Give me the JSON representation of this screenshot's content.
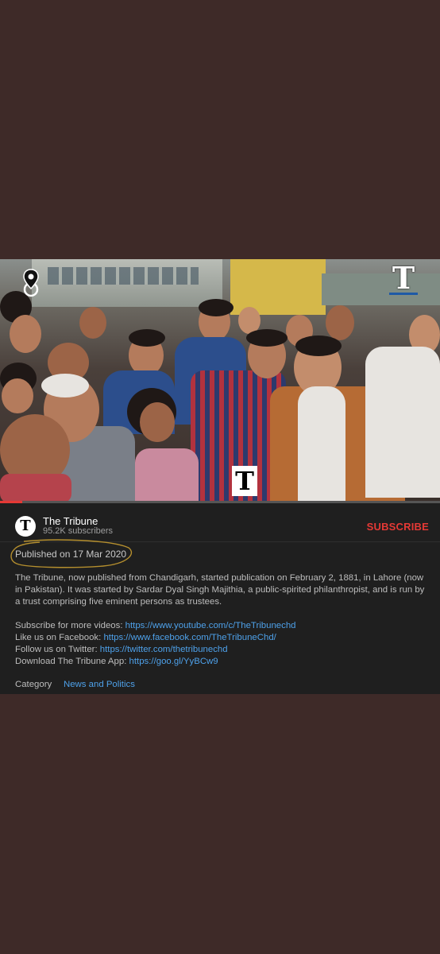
{
  "video": {
    "logo_letter": "T",
    "progress_fraction": 0.05,
    "icons": {
      "location": "location-pin-icon",
      "logo": "tribune-logo-icon"
    }
  },
  "channel": {
    "avatar_letter": "T",
    "name": "The Tribune",
    "subscribers": "95.2K subscribers",
    "subscribe_label": "SUBSCRIBE"
  },
  "published": "Published on 17 Mar 2020",
  "description": {
    "paragraph": "The Tribune, now published from Chandigarh, started publication on February 2, 1881, in Lahore (now in Pakistan). It was started by Sardar Dyal Singh Majithia, a public-spirited philanthropist, and is run by a trust comprising five eminent persons as trustees.",
    "links": [
      {
        "prefix": "Subscribe for more videos: ",
        "url": "https://www.youtube.com/c/TheTribunechd"
      },
      {
        "prefix": "Like us on Facebook: ",
        "url": "https://www.facebook.com/TheTribuneChd/"
      },
      {
        "prefix": "Follow us on Twitter: ",
        "url": "https://twitter.com/thetribunechd"
      },
      {
        "prefix": "Download The Tribune App: ",
        "url": "https://goo.gl/YyBCw9"
      }
    ]
  },
  "category": {
    "label": "Category",
    "value": "News and Politics"
  },
  "colors": {
    "background": "#3e2a28",
    "panel": "#1f1f1f",
    "accent_red": "#e53935",
    "link_blue": "#4ea1ea"
  }
}
